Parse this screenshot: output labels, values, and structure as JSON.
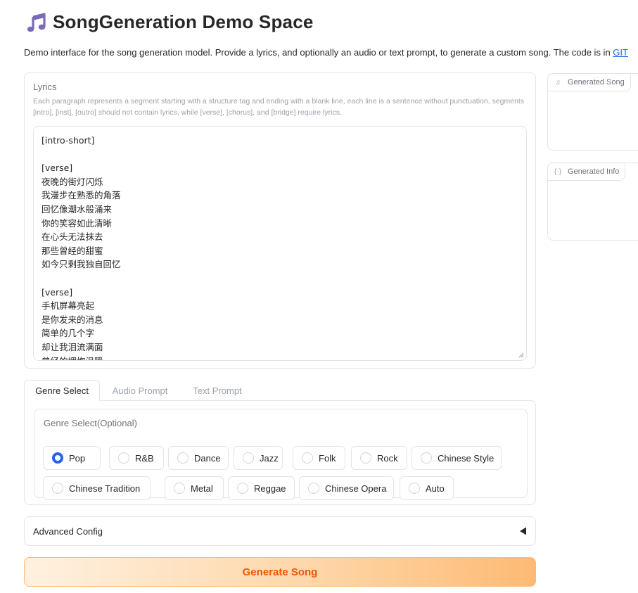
{
  "header": {
    "title": "SongGeneration Demo Space",
    "description": "Demo interface for the song generation model. Provide a lyrics, and optionally an audio or text prompt, to generate a custom song. The code is in ",
    "git_link": "GIT"
  },
  "lyrics": {
    "label": "Lyrics",
    "info": "Each paragraph represents a segment starting with a structure tag and ending with a blank line, each line is a sentence without punctuation, segments [intro], [inst], [outro] should not contain lyrics, while [verse], [chorus], and [bridge] require lyrics.",
    "lines": [
      "[intro-short]",
      "",
      "[verse]",
      "夜晚的街灯闪烁",
      "我漫步在熟悉的角落",
      "回忆像潮水般涌来",
      "你的笑容如此清晰",
      "在心头无法抹去",
      "那些曾经的甜蜜",
      "如今只剩我独自回忆",
      "",
      "[verse]",
      "手机屏幕亮起",
      "是你发来的消息",
      "简单的几个字",
      "却让我泪流满面",
      "曾经的拥抱温暖"
    ]
  },
  "side": {
    "song_label": "Generated Song",
    "info_label": "Generated Info"
  },
  "tabs": [
    {
      "label": "Genre Select",
      "active": true
    },
    {
      "label": "Audio Prompt",
      "active": false
    },
    {
      "label": "Text Prompt",
      "active": false
    }
  ],
  "genre": {
    "label": "Genre Select(Optional)",
    "selected": "Pop",
    "options": [
      "Pop",
      "R&B",
      "Dance",
      "Jazz",
      "Folk",
      "Rock",
      "Chinese Style",
      "Chinese Tradition",
      "Metal",
      "Reggae",
      "Chinese Opera",
      "Auto"
    ]
  },
  "advanced": {
    "label": "Advanced Config",
    "caret": "◀"
  },
  "generate": {
    "label": "Generate Song"
  },
  "colors": {
    "accent": "#2563eb",
    "button_text": "#ea580c",
    "button_gradient_end": "#fdba74"
  }
}
